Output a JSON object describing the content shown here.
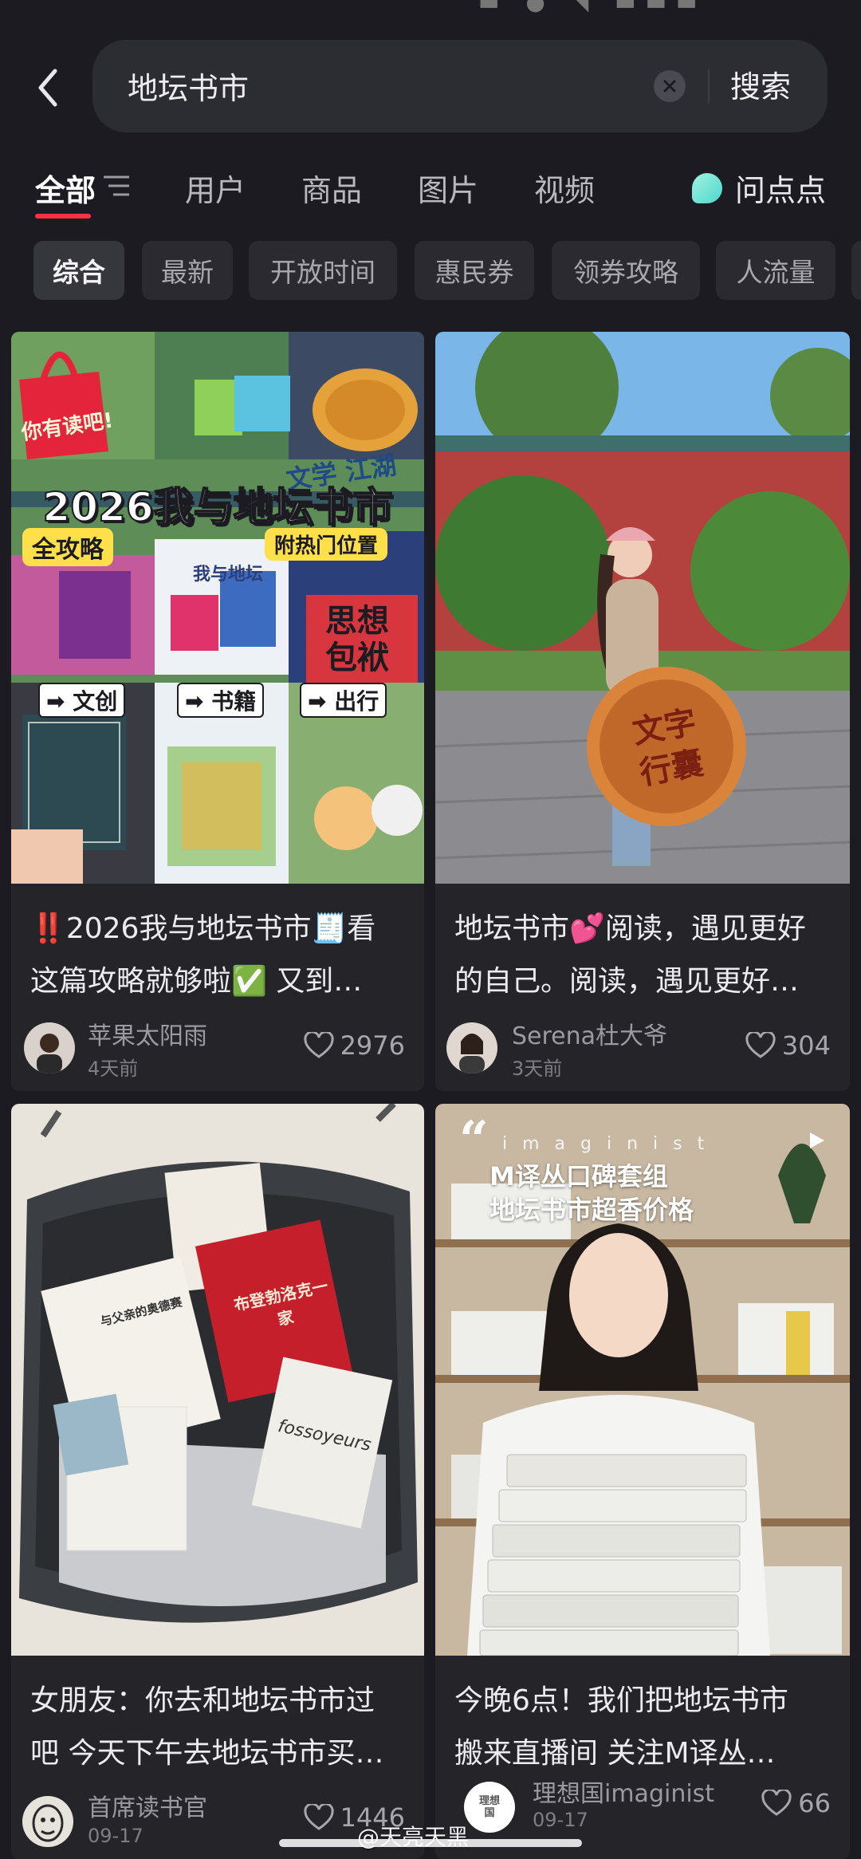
{
  "search": {
    "query": "地坛书市",
    "button_label": "搜索"
  },
  "tabs": [
    {
      "label": "全部",
      "active": true
    },
    {
      "label": "用户"
    },
    {
      "label": "商品"
    },
    {
      "label": "图片"
    },
    {
      "label": "视频"
    }
  ],
  "ask_label": "问点点",
  "chips": [
    {
      "label": "综合",
      "active": true
    },
    {
      "label": "最新"
    },
    {
      "label": "开放时间"
    },
    {
      "label": "惠民券"
    },
    {
      "label": "领券攻略"
    },
    {
      "label": "人流量"
    }
  ],
  "posts": [
    {
      "title_line1": "‼️2026我与地坛书市🧾看",
      "title_line2": "这篇攻略就够啦✅ 又到…",
      "author": "苹果太阳雨",
      "date": "4天前",
      "likes": "2976",
      "cover": {
        "headline": "2026我与地坛书市",
        "badge_left": "全攻略",
        "badge_right": "附热门位置",
        "bag_text": "你有读吧!",
        "tag1": "文创",
        "tag2": "书籍",
        "tag3": "出行",
        "banner_text": "我与地坛",
        "poster_text": "思想 包袱",
        "yellow_text": "文学 江湖"
      }
    },
    {
      "title_line1": "地坛书市💕阅读，遇见更好",
      "title_line2": "的自己。阅读，遇见更好…",
      "author": "Serena杜大爷",
      "date": "3天前",
      "likes": "304",
      "cover": {
        "sign_text": "文字 行囊"
      }
    },
    {
      "title_line1": "女朋友：你去和地坛书市过",
      "title_line2": "吧 今天下午去地坛书市买…",
      "author": "首席读书官",
      "date": "09-17",
      "likes": "1446",
      "cover": {
        "book1": "与父亲的奥德赛",
        "book2": "布登勃洛克一家",
        "book3": "fossoyeurs"
      }
    },
    {
      "title_line1": "今晚6点！我们把地坛书市",
      "title_line2": "搬来直播间 关注M译丛…",
      "author": "理想国imaginist",
      "date": "09-17",
      "likes": "66",
      "cover": {
        "brand": "i m a g i n i s t",
        "headline1": "M译丛口碑套组",
        "headline2": "地坛书市超香价格"
      }
    }
  ],
  "avatar_text": "理想国",
  "watermark": "@天亮天黑",
  "statusbar_text": "▬ ● ◥ ▬▬▬"
}
